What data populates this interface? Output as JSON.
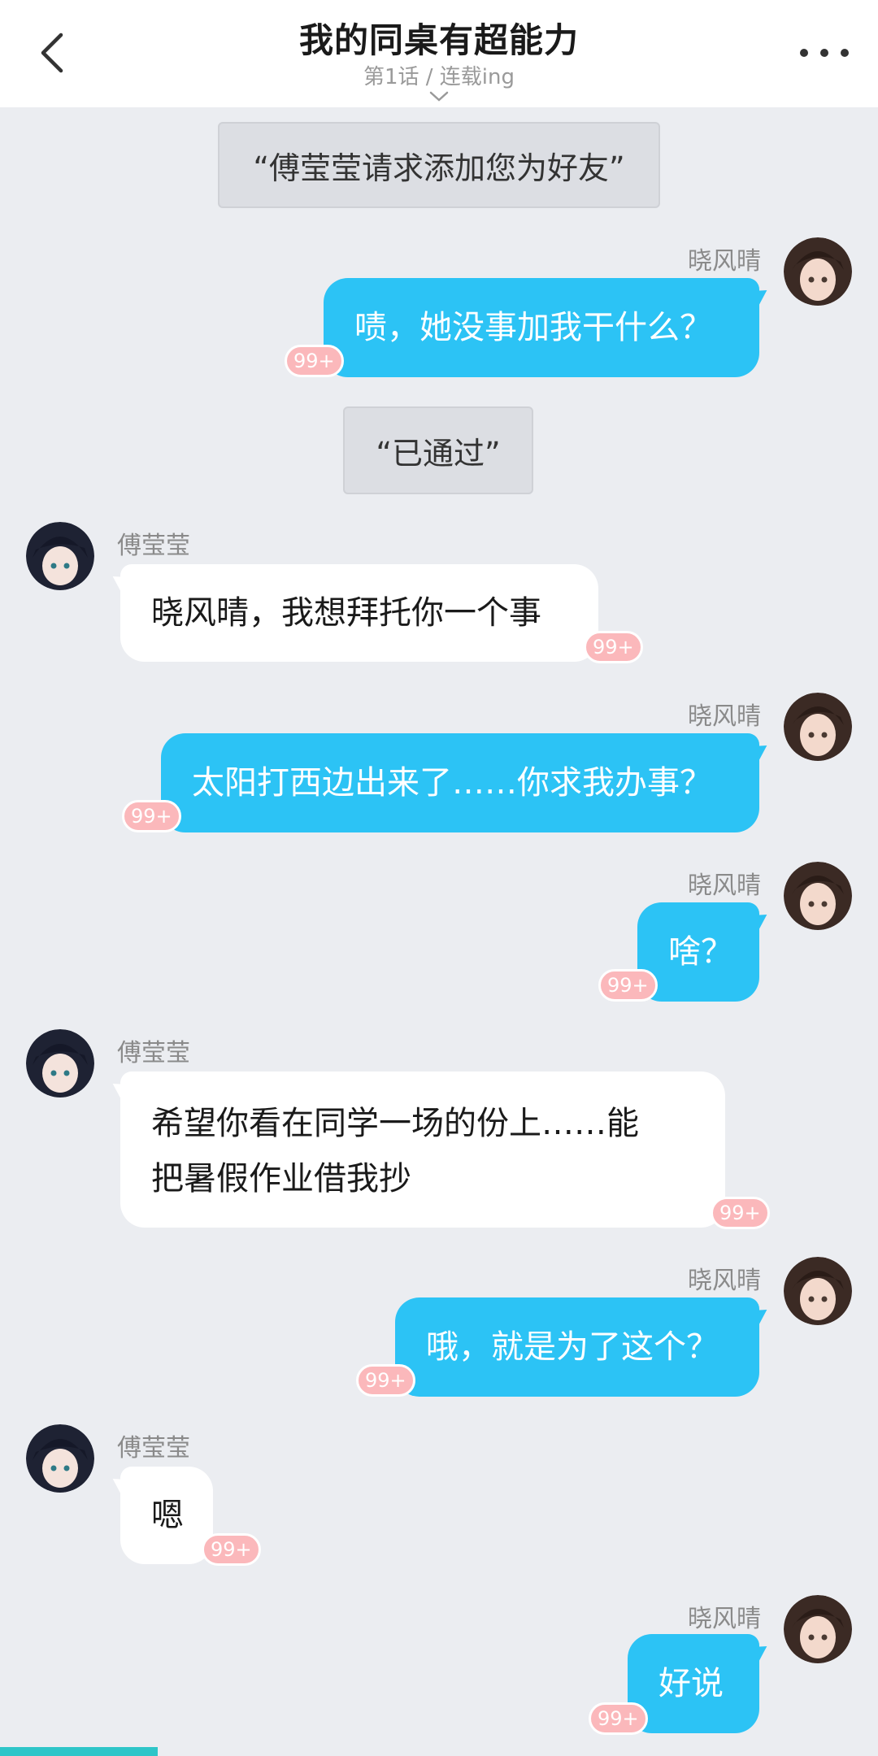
{
  "header": {
    "title": "我的同桌有超能力",
    "subtitle": "第1话 / 连载ing",
    "back_icon": "chevron-left-icon",
    "more_icon": "more-dots-icon"
  },
  "badge_label": "99+",
  "reading_progress_pct": 18,
  "colors": {
    "right_bubble": "#2cc3f5",
    "left_bubble": "#ffffff",
    "badge": "#fbb8bb",
    "background": "#ebedf1"
  },
  "messages": [
    {
      "type": "notice",
      "text": "“傅莹莹请求添加您为好友”"
    },
    {
      "type": "right",
      "name": "晓风晴",
      "text": "啧，她没事加我干什么？"
    },
    {
      "type": "notice",
      "text": "“已通过”"
    },
    {
      "type": "left",
      "name": "傅莹莹",
      "text": "晓风晴，我想拜托你一个事"
    },
    {
      "type": "right",
      "name": "晓风晴",
      "text": "太阳打西边出来了……你求我办事？"
    },
    {
      "type": "right",
      "name": "晓风晴",
      "text": "啥？"
    },
    {
      "type": "left",
      "name": "傅莹莹",
      "lines": [
        "希望你看在同学一场的份上……能",
        "把暑假作业借我抄"
      ]
    },
    {
      "type": "right",
      "name": "晓风晴",
      "text": "哦，就是为了这个？"
    },
    {
      "type": "left",
      "name": "傅莹莹",
      "text": "嗯"
    },
    {
      "type": "right",
      "name": "晓风晴",
      "text": "好说"
    }
  ]
}
